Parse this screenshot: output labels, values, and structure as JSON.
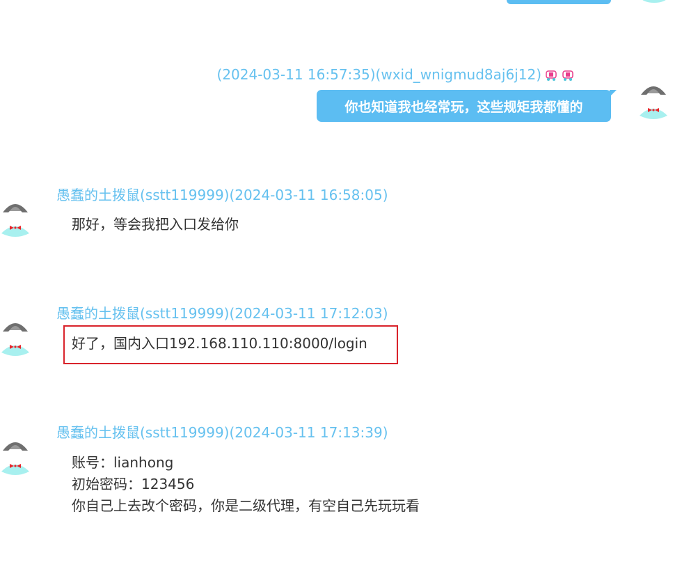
{
  "messages": [
    {
      "side": "right",
      "meta": "(2024-03-11 16:57:35)(wxid_wnigmud8aj6j12)",
      "text": "你也知道我也经常玩，这些规矩我都懂的"
    },
    {
      "side": "left",
      "meta": "愚蠢的土拨鼠(sstt119999)(2024-03-11 16:58:05)",
      "lines": [
        "那好，等会我把入口发给你"
      ]
    },
    {
      "side": "left",
      "meta": "愚蠢的土拨鼠(sstt119999)(2024-03-11 17:12:03)",
      "lines": [
        "好了，国内入口192.168.110.110:8000/login"
      ],
      "highlighted": true
    },
    {
      "side": "left",
      "meta": "愚蠢的土拨鼠(sstt119999)(2024-03-11 17:13:39)",
      "lines": [
        "账号：lianhong",
        "初始密码：123456",
        "你自己上去改个密码，你是二级代理，有空自己先玩玩看"
      ]
    }
  ],
  "icons": {
    "avatar": "cartoon-avatar-icon",
    "emoji": "emoji-sticker-icon"
  },
  "colors": {
    "bubble": "#5cbdf2",
    "meta": "#66c1ef",
    "highlight": "#d9232b"
  }
}
